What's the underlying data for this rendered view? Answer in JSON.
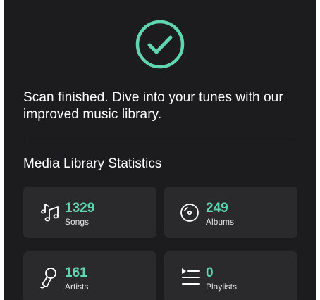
{
  "colors": {
    "background": "#1c1c1e",
    "card": "#2a2a2c",
    "accent": "#5fd6b0",
    "text": "#ffffff"
  },
  "status": {
    "icon": "checkmark-circle-icon",
    "message": "Scan finished. Dive into your tunes with our improved music library."
  },
  "stats": {
    "title": "Media Library Statistics",
    "items": [
      {
        "icon": "music-notes-icon",
        "count": "1329",
        "label": "Songs"
      },
      {
        "icon": "album-disc-icon",
        "count": "249",
        "label": "Albums"
      },
      {
        "icon": "microphone-icon",
        "count": "161",
        "label": "Artists"
      },
      {
        "icon": "playlist-icon",
        "count": "0",
        "label": "Playlists"
      }
    ]
  }
}
